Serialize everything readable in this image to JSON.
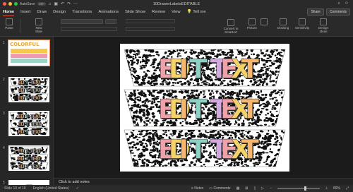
{
  "titlebar": {
    "autosave": "AutoSave",
    "autosave_state": "OFF",
    "filename": "10DrawerLabelsEDITABLE"
  },
  "tabs": [
    "Home",
    "Insert",
    "Draw",
    "Design",
    "Transitions",
    "Animations",
    "Slide Show",
    "Review",
    "View",
    "Tell me"
  ],
  "tab_actions": {
    "share": "Share",
    "comments": "Comments"
  },
  "ribbon": {
    "paste": "Paste",
    "new_slide": "New Slide",
    "convert": "Convert to SmartArt",
    "picture": "Picture",
    "drawing": "Drawing",
    "sensitivity": "Sensitivity",
    "design_ideas": "Design Ideas"
  },
  "slide_text": "EDIT TEXT",
  "thumbnail_title": "COLORFUL",
  "thumb_numbers": [
    "1",
    "2",
    "3",
    "4",
    "5"
  ],
  "notes_placeholder": "Click to add notes",
  "status": {
    "slide": "Slide 10 of 10",
    "language": "English (United States)",
    "notes": "Notes",
    "comments": "Comments",
    "zoom": "89%"
  },
  "colors": {
    "letter_colors": [
      "#f0a0a8",
      "#f4d268",
      "#f6b66e",
      "#8ed2c6",
      "#a6b8e0",
      "#d4a8e0"
    ],
    "accent": "#e05a3a"
  }
}
